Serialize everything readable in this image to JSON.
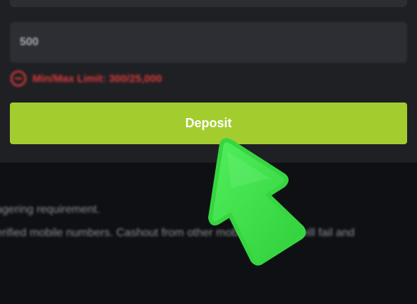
{
  "form": {
    "amount_value": "500",
    "limit_text": "Min/Max Limit: 300/25,000",
    "deposit_label": "Deposit"
  },
  "info": {
    "line1": "agering requirement.",
    "line2": "erified mobile numbers. Cashout from other mobile numbers will fail and"
  },
  "icons": {
    "limit": "alert-circle-icon",
    "pointer": "arrow-pointer-icon"
  },
  "colors": {
    "background": "#0f1013",
    "panel": "#1f2024",
    "input": "#2c2e33",
    "deposit_button": "#a3cc2f",
    "error": "#d93a3a",
    "arrow": "#3ee04a"
  }
}
